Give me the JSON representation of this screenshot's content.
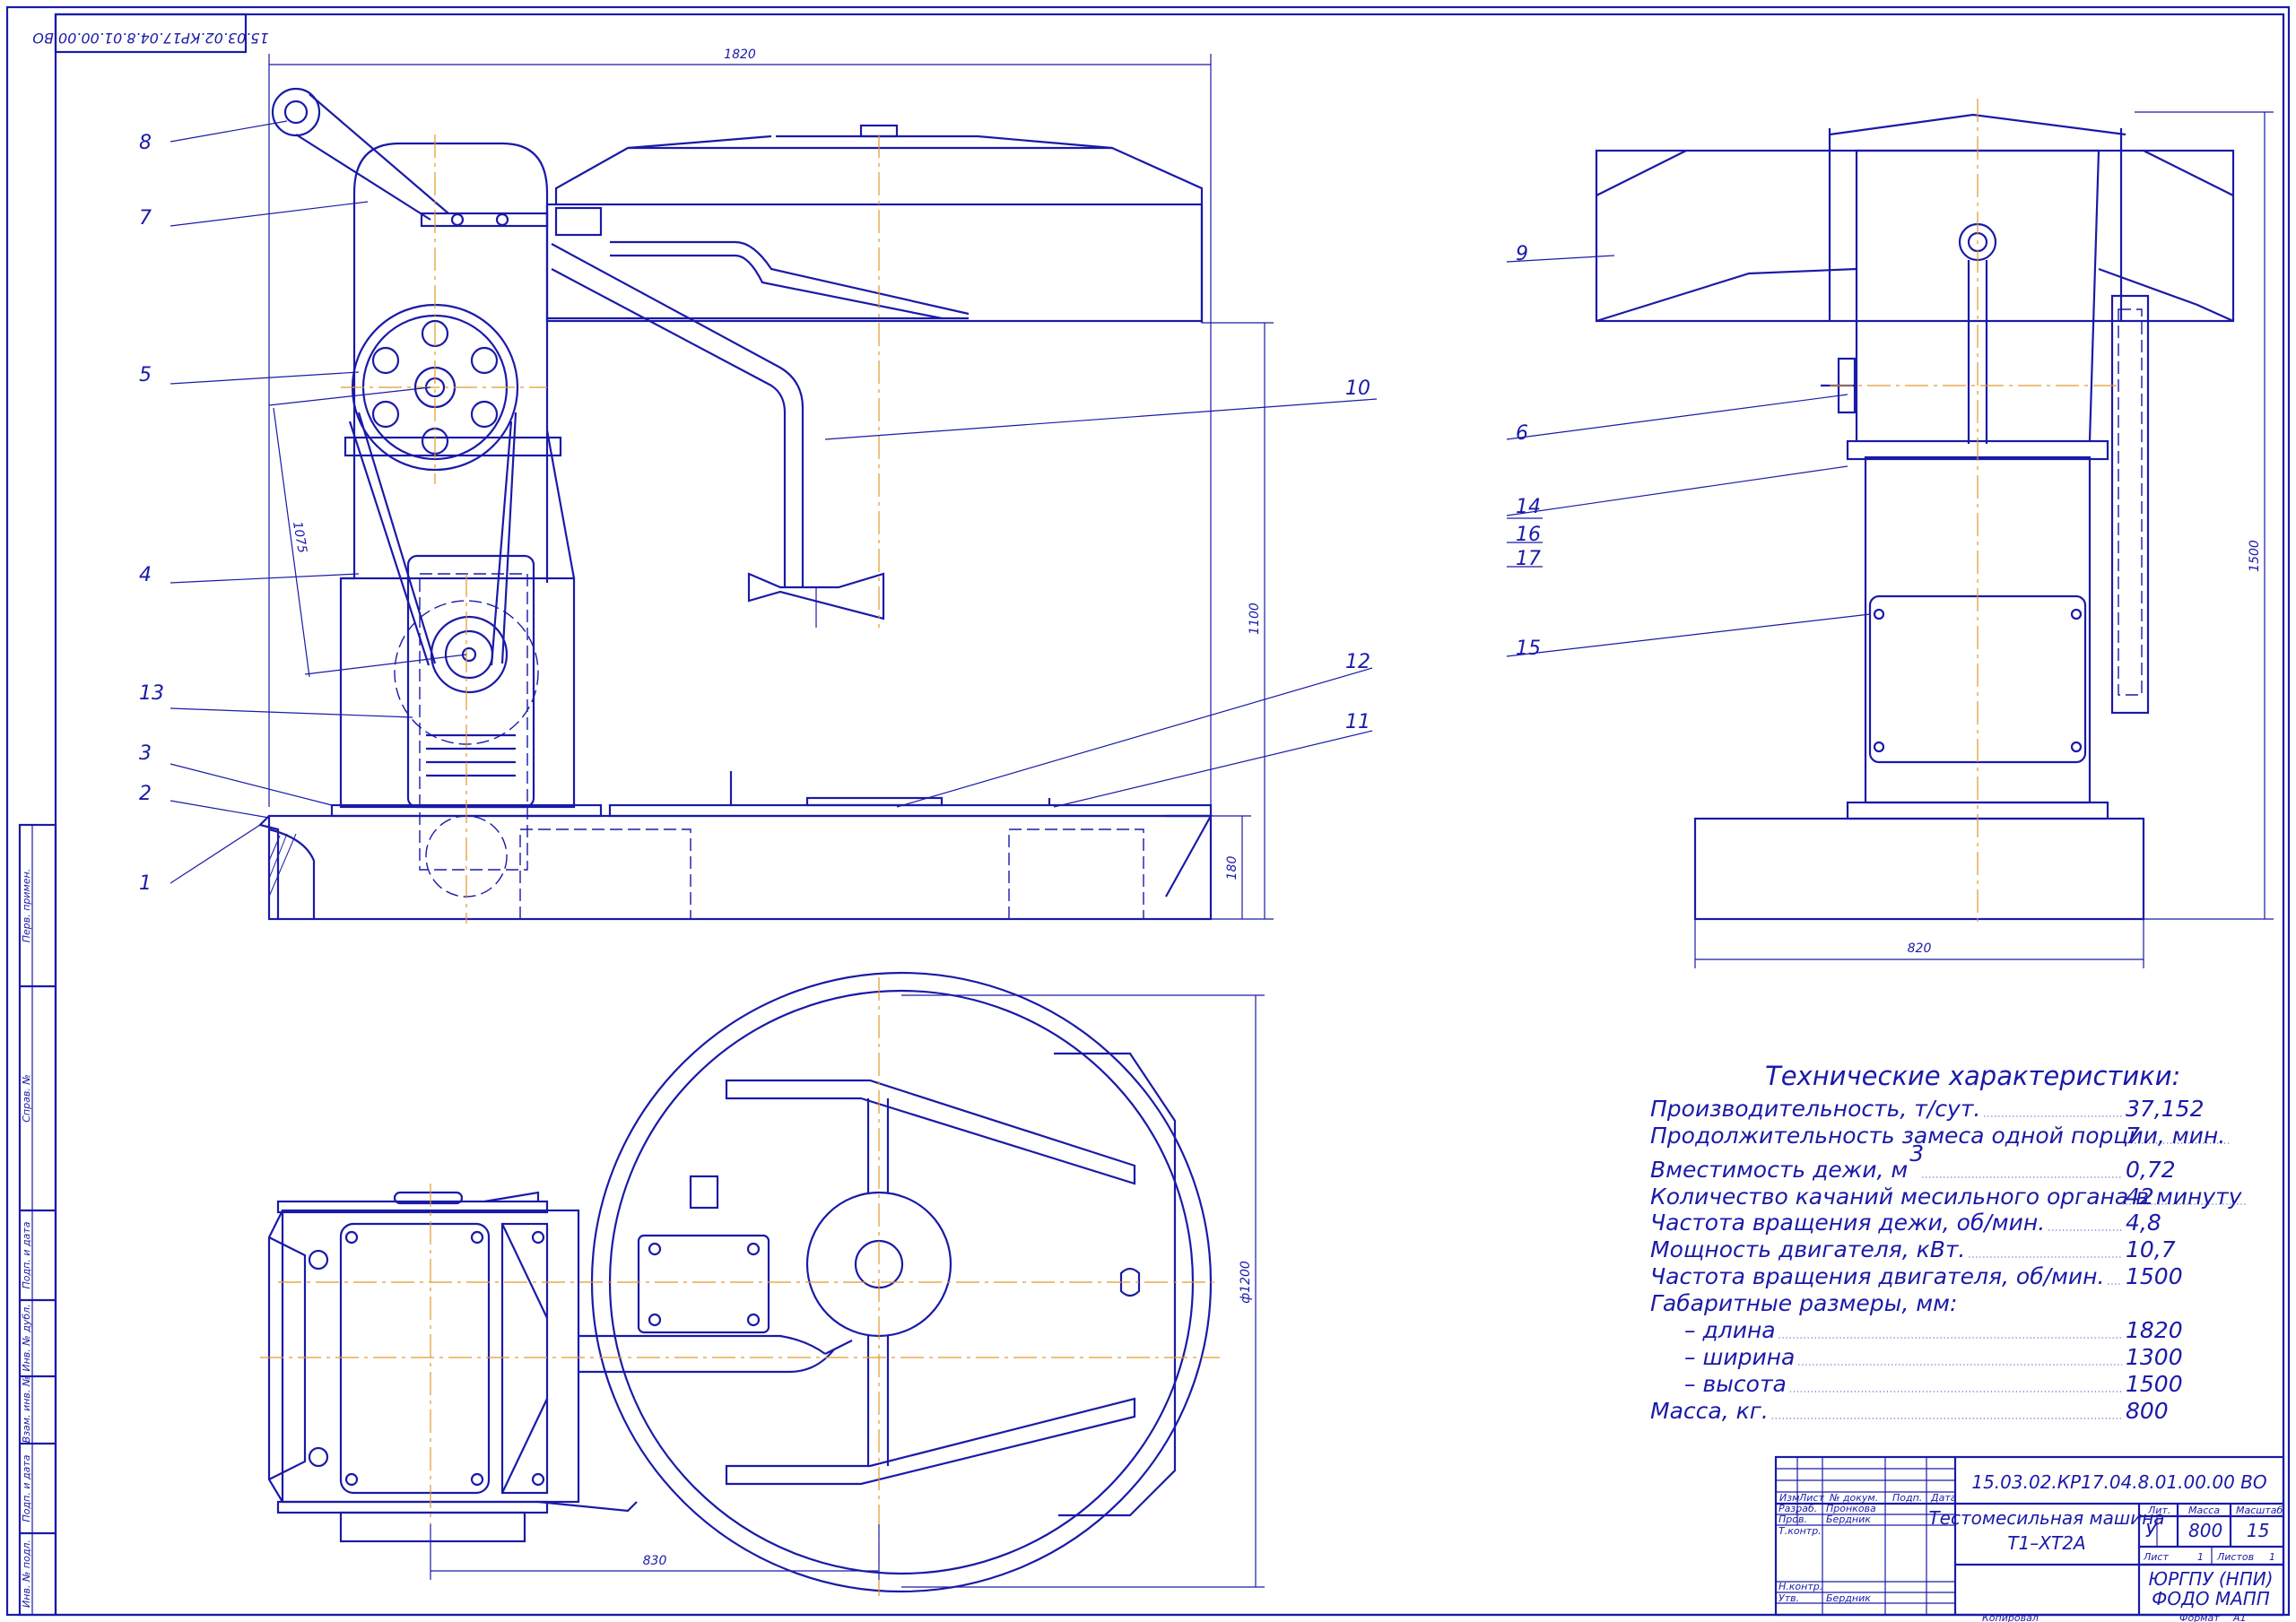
{
  "drawing": {
    "code": "15.03.02.КР17.04.8.01.00.00 ВО",
    "code_rotated": "15.03.02.КР17.04.8.01.00.00 ВО"
  },
  "callouts": [
    "1",
    "2",
    "3",
    "4",
    "5",
    "6",
    "7",
    "8",
    "9",
    "10",
    "11",
    "12",
    "13",
    "14",
    "15",
    "16",
    "17"
  ],
  "dimensions": {
    "length_top": "1820",
    "height_right": "1100",
    "base_height": "180",
    "belt": "1075",
    "side_height": "1500",
    "side_width": "820",
    "plan_diameter": "ф1200",
    "plan_width": "830"
  },
  "specs": {
    "title": "Технические характеристики:",
    "rows": [
      {
        "label": "Производительность, т/сут.",
        "value": "37,152"
      },
      {
        "label": "Продолжительность замеса одной порции, мин.",
        "value": "7"
      },
      {
        "label": "Вместимость дежи, м",
        "sup": "3",
        "value": "0,72"
      },
      {
        "label": "Количество качаний месильного органа в минуту",
        "value": "42"
      },
      {
        "label": "Частота вращения дежи, об/мин.",
        "value": "4,8"
      },
      {
        "label": "Мощность двигателя, кВт.",
        "value": "10,7"
      },
      {
        "label": "Частота вращения двигателя, об/мин.",
        "value": "1500"
      },
      {
        "label": "Габаритные размеры, мм:",
        "value": ""
      },
      {
        "label": "– длина",
        "value": "1820"
      },
      {
        "label": "– ширина",
        "value": "1300"
      },
      {
        "label": "– высота",
        "value": "1500"
      },
      {
        "label": "Масса, кг.",
        "value": "800"
      }
    ]
  },
  "title_block": {
    "name_line1": "Тестомесильная машина",
    "name_line2": "Т1–ХТ2А",
    "lit_label": "Лит.",
    "mass_label": "Масса",
    "scale_label": "Масштаб",
    "lit_value": "У",
    "mass_value": "800",
    "scale_value": "15",
    "sheet_label": "Лист",
    "sheet_value": "1",
    "sheets_label": "Листов",
    "sheets_value": "1",
    "org_line1": "ЮРГПУ (НПИ)",
    "org_line2": "ФОДО МАПП",
    "copied": "Копировал",
    "format_label": "Формат",
    "format_value": "А1",
    "header": {
      "izm": "Изм",
      "list": "Лист",
      "doc": "№ докум.",
      "sign": "Подп.",
      "date": "Дата"
    },
    "roles": [
      {
        "role": "Разраб.",
        "name": "Пронкова"
      },
      {
        "role": "Пров.",
        "name": "Бердник"
      },
      {
        "role": "Т.контр.",
        "name": ""
      },
      {
        "role": "Н.контр.",
        "name": ""
      },
      {
        "role": "Утв.",
        "name": "Бердник"
      }
    ]
  },
  "side_stamp": {
    "cells": [
      "Перв. примен.",
      "Справ. №",
      "Подп. и дата",
      "Инв. № дубл.",
      "Взам. инв. №",
      "Подп. и дата",
      "Инв. № подл."
    ]
  }
}
